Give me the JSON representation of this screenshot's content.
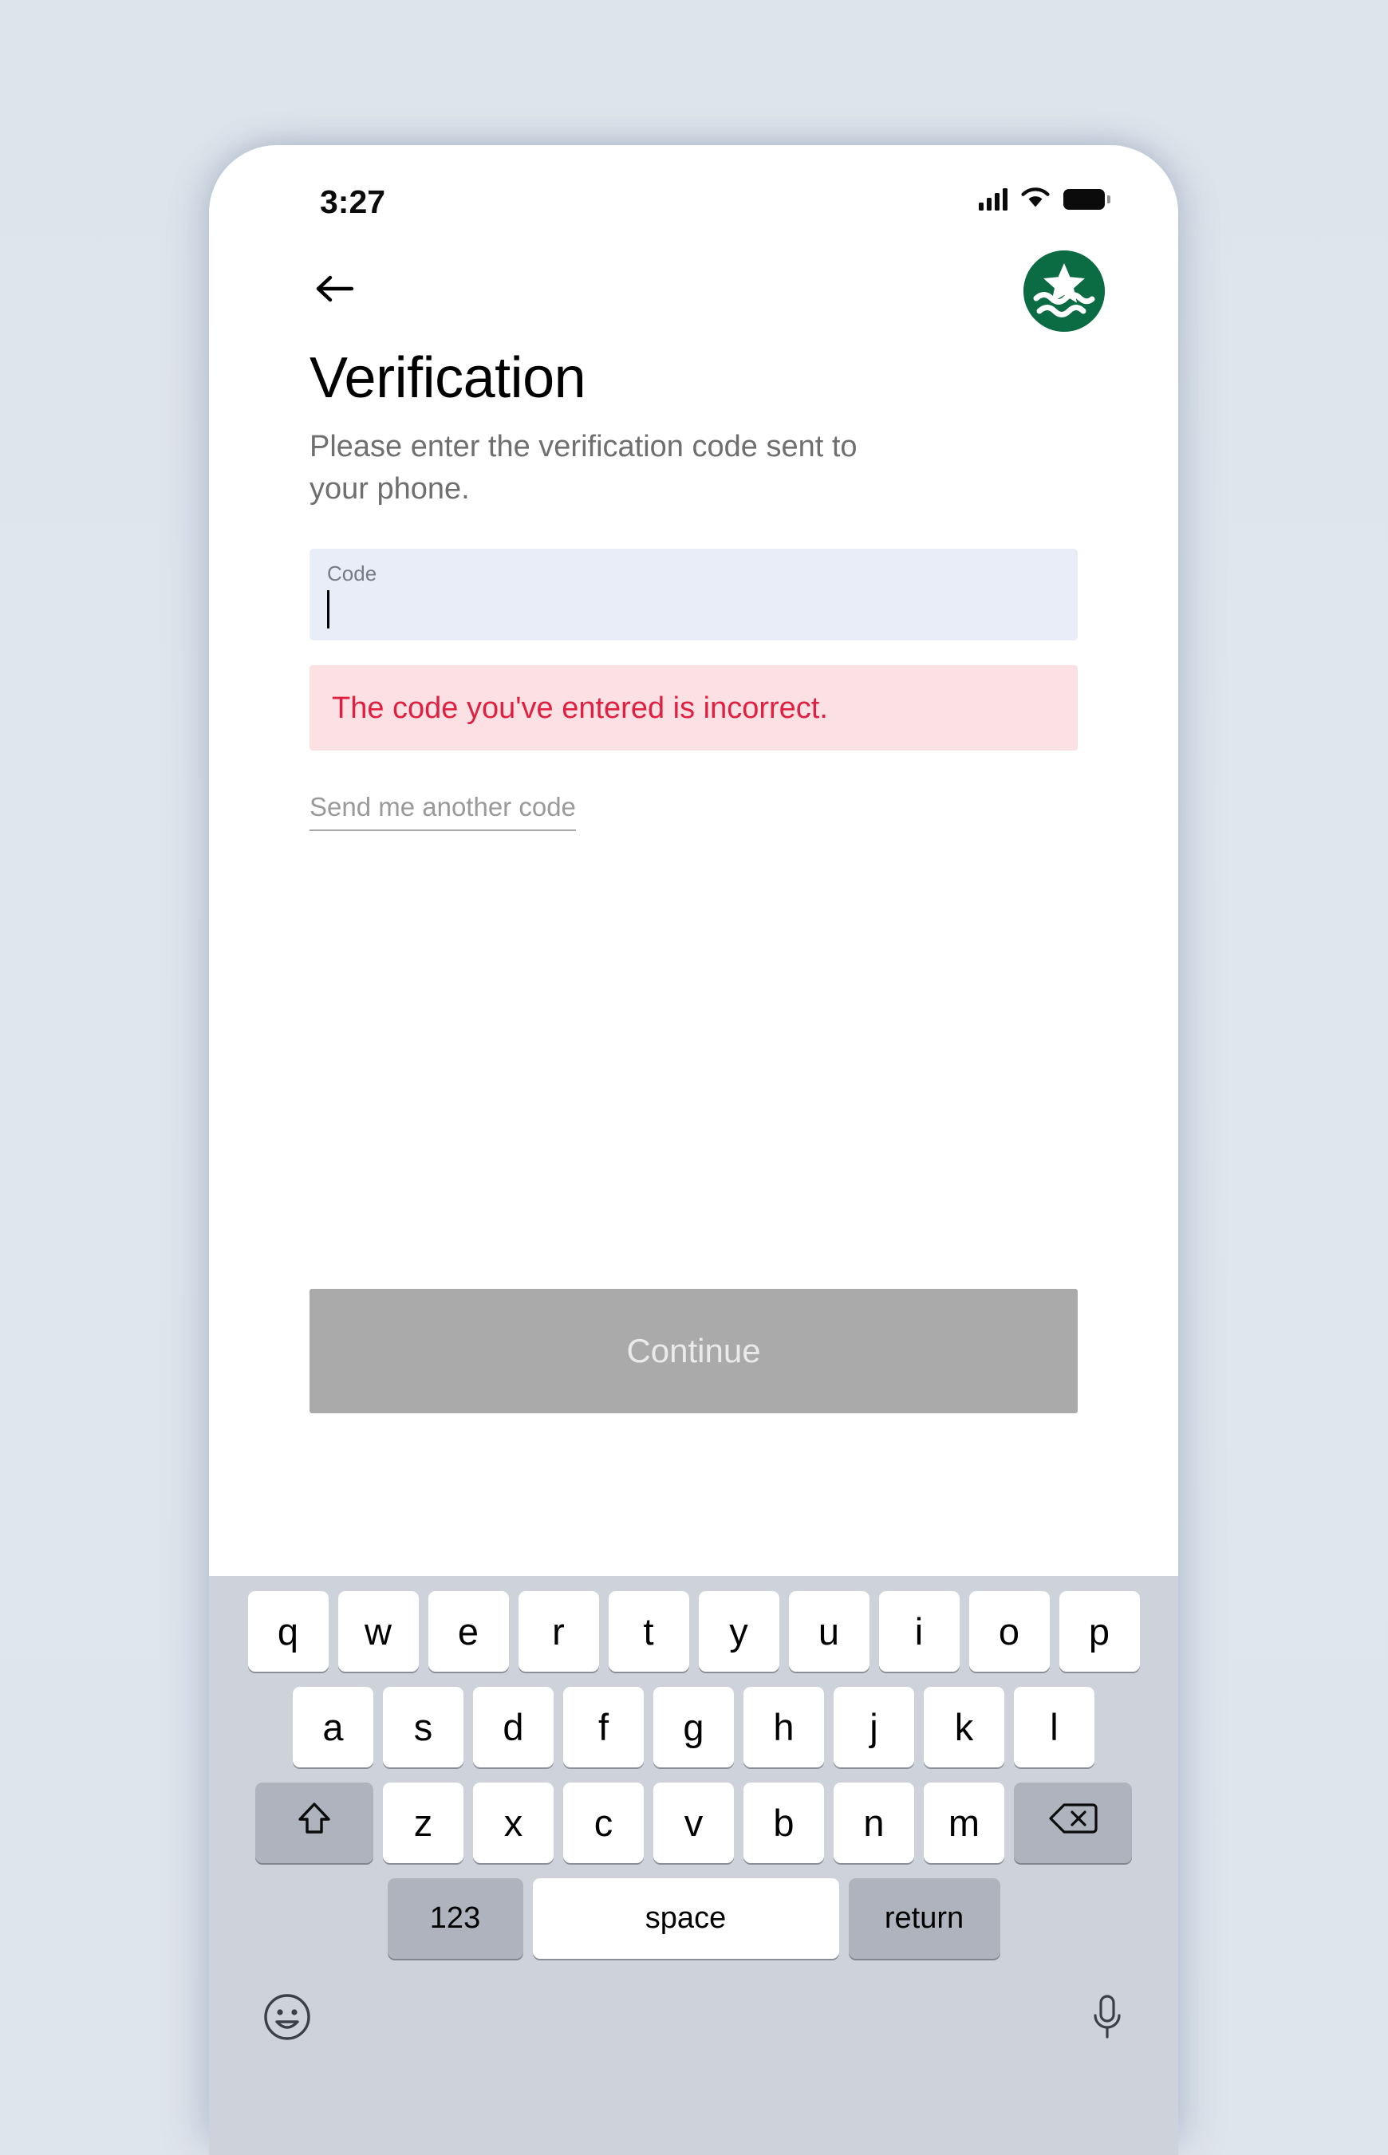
{
  "status_bar": {
    "time": "3:27",
    "signal_icon": "cellular-signal-icon",
    "wifi_icon": "wifi-icon",
    "battery_icon": "battery-icon"
  },
  "header": {
    "back_icon": "back-arrow-icon",
    "logo_icon": "brand-logo-icon",
    "logo_color": "#0b6b43"
  },
  "main": {
    "title": "Verification",
    "subtitle": "Please enter the verification code sent to your phone.",
    "code_field": {
      "label": "Code",
      "value": "",
      "placeholder": "",
      "background": "#e9edf8"
    },
    "error": {
      "message": "The code you've entered is incorrect.",
      "text_color": "#e02040",
      "background": "#fbe1e4"
    },
    "resend_link": "Send me another code",
    "continue_button": {
      "label": "Continue",
      "background": "#aaaaaa",
      "enabled": false
    }
  },
  "keyboard": {
    "row1": [
      "q",
      "w",
      "e",
      "r",
      "t",
      "y",
      "u",
      "i",
      "o",
      "p"
    ],
    "row2": [
      "a",
      "s",
      "d",
      "f",
      "g",
      "h",
      "j",
      "k",
      "l"
    ],
    "row3": [
      "z",
      "x",
      "c",
      "v",
      "b",
      "n",
      "m"
    ],
    "shift_key": "shift-icon",
    "backspace_key": "backspace-icon",
    "numbers_key": "123",
    "space_key": "space",
    "return_key": "return",
    "emoji_key": "emoji-icon",
    "mic_key": "microphone-icon",
    "background": "#ced2da"
  }
}
